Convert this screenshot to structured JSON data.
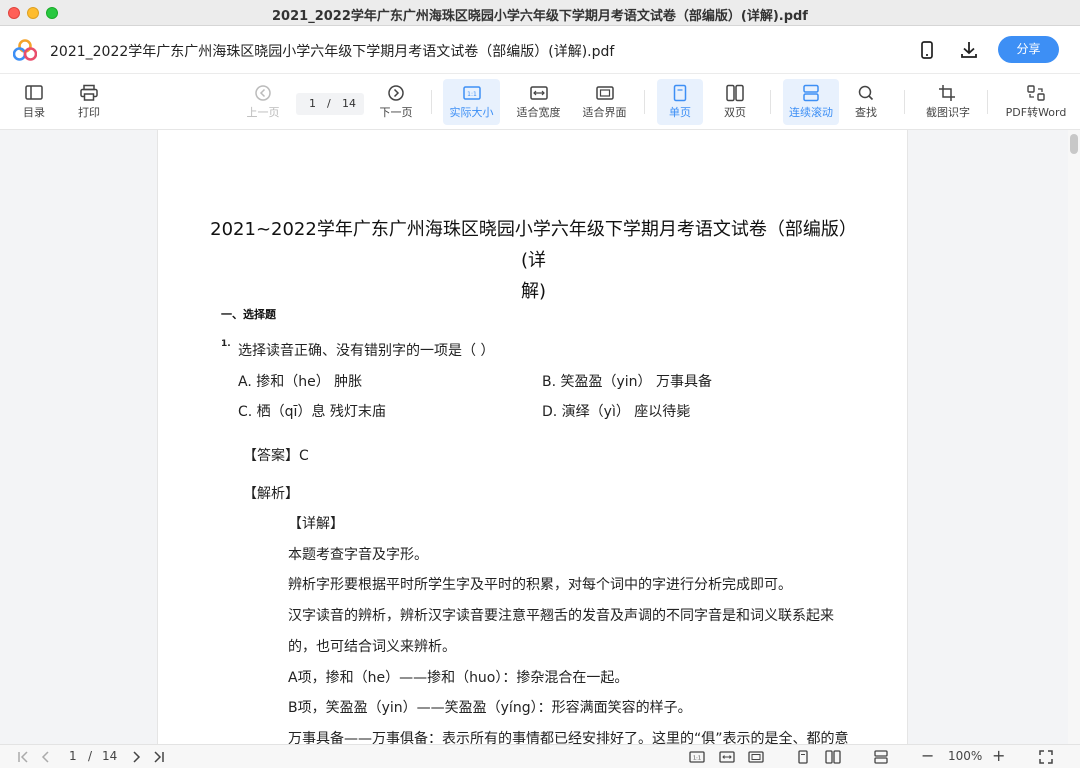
{
  "window": {
    "title": "2021_2022学年广东广州海珠区晓园小学六年级下学期月考语文试卷（部编版）(详解).pdf"
  },
  "header": {
    "doc_title": "2021_2022学年广东广州海珠区晓园小学六年级下学期月考语文试卷（部编版）(详解).pdf",
    "share_label": "分享",
    "icons": [
      "app-logo-icon",
      "phone-icon",
      "download-icon"
    ]
  },
  "toolbar": {
    "toc_label": "目录",
    "print_label": "打印",
    "prev_label": "上一页",
    "current_page": "1",
    "page_sep": "/",
    "total_pages": "14",
    "next_label": "下一页",
    "actual_size_label": "实际大小",
    "fit_width_label": "适合宽度",
    "fit_page_label": "适合界面",
    "single_page_label": "单页",
    "double_page_label": "双页",
    "continuous_label": "连续滚动",
    "search_label": "查找",
    "ocr_label": "截图识字",
    "to_word_label": "PDF转Word",
    "accent_color": "#3d8ff5"
  },
  "document": {
    "title_line1": "2021~2022学年广东广州海珠区晓园小学六年级下学期月考语文试卷（部编版）(详",
    "title_line2": "解)",
    "section": "一、选择题",
    "q_number": "1.",
    "question": "选择读音正确、没有错别字的一项是（        ）",
    "options": [
      "A. 掺和（he）        肿胀",
      "B. 笑盈盈（yin）      万事具备",
      "C. 栖（qī）息       残灯末庙",
      "D. 演绎（yì）       座以待毙"
    ],
    "answer": "【答案】C",
    "analysis_heading": "【解析】",
    "detail_lines": [
      "【详解】",
      "本题考查字音及字形。",
      "辨析字形要根据平时所学生字及平时的积累，对每个词中的字进行分析完成即可。",
      "汉字读音的辨析，辨析汉字读音要注意平翘舌的发音及声调的不同字音是和词义联系起来",
      "的，也可结合词义来辨析。",
      "A项，掺和（he）——掺和（huo）：掺杂混合在一起。",
      "B项，笑盈盈（yin）——笑盈盈（yíng）：形容满面笑容的样子。",
      "万事具备——万事俱备：表示所有的事情都已经安排好了。这里的“俱”表示的是全、都的意"
    ]
  },
  "statusbar": {
    "current_page": "1",
    "page_sep": "/",
    "total_pages": "14",
    "zoom": "100%",
    "zoom_out": "−",
    "zoom_in": "+"
  }
}
